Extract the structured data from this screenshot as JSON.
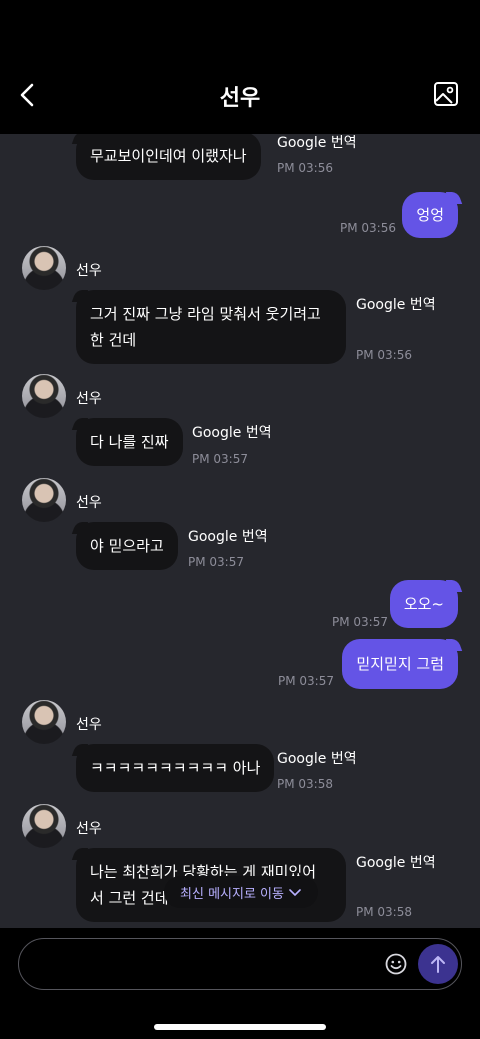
{
  "header": {
    "title": "선우",
    "back_icon": "chevron-left-icon",
    "gallery_icon": "image-icon"
  },
  "messages": [
    {
      "dir": "in",
      "sender": null,
      "lines": [
        "무교보이인데여 이랬자나"
      ],
      "translate": "Google 번역",
      "time": "PM 03:56"
    },
    {
      "dir": "out",
      "text": "엉엉",
      "time": "PM 03:56"
    },
    {
      "dir": "in",
      "sender": "선우",
      "lines": [
        "그거 진짜 그냥 라임 맞춰서 웃기려고",
        "한 건데"
      ],
      "translate": "Google 번역",
      "time": "PM 03:56"
    },
    {
      "dir": "in",
      "sender": "선우",
      "lines": [
        "다 나를 진짜"
      ],
      "translate": "Google 번역",
      "time": "PM 03:57"
    },
    {
      "dir": "in",
      "sender": "선우",
      "lines": [
        "야 믿으라고"
      ],
      "translate": "Google 번역",
      "time": "PM 03:57"
    },
    {
      "dir": "out",
      "text": "오오~",
      "time": "PM 03:57"
    },
    {
      "dir": "out",
      "text": "믿지믿지 그럼",
      "time": "PM 03:57"
    },
    {
      "dir": "in",
      "sender": "선우",
      "lines": [
        "ㅋㅋㅋㅋㅋㅋㅋㅋㅋㅋ 아나"
      ],
      "translate": "Google 번역",
      "time": "PM 03:58"
    },
    {
      "dir": "in",
      "sender": "선우",
      "lines": [
        "나는 최찬희가 당황하는 게 재미있어",
        "서 그런 건데"
      ],
      "translate": "Google 번역",
      "time": "PM 03:58"
    }
  ],
  "jump_to_latest": {
    "label": "최신 메시지로 이동",
    "icon": "chevron-down-icon"
  },
  "composer": {
    "placeholder": "",
    "emoji_icon": "smiley-icon",
    "send_icon": "arrow-up-icon"
  },
  "colors": {
    "accent": "#6454e6",
    "chat_bg": "#26272d",
    "bubble_in": "#141416"
  }
}
